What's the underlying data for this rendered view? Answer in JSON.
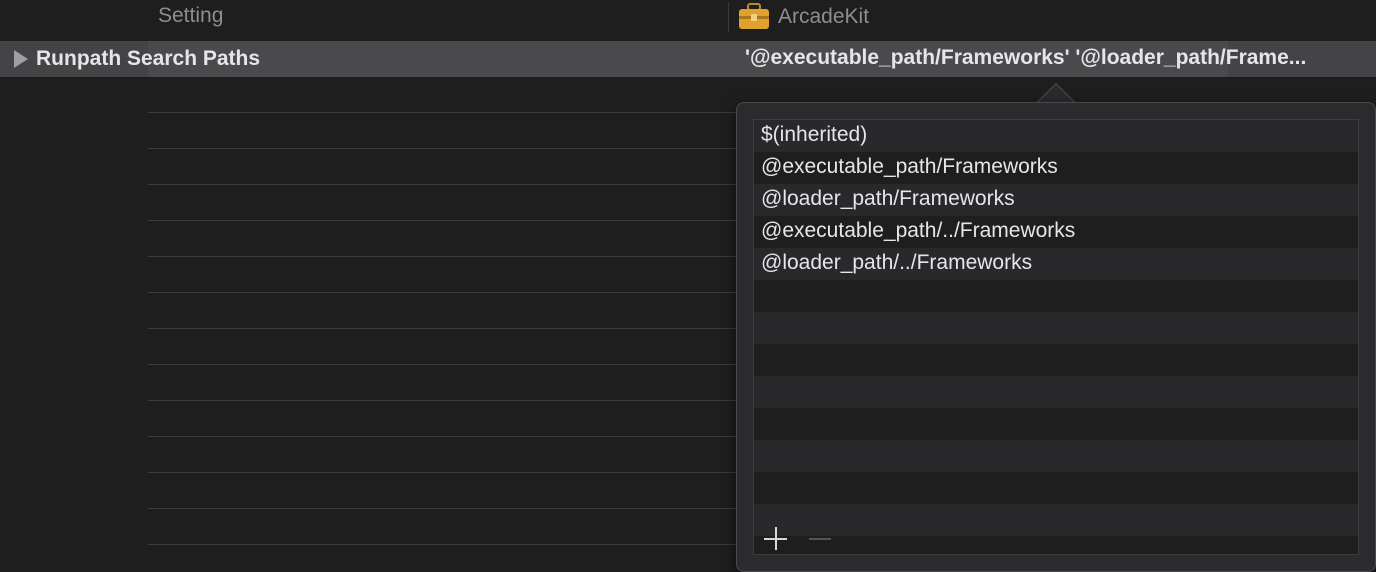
{
  "header": {
    "setting_column": "Setting",
    "target_column": "ArcadeKit",
    "target_icon": "toolbox-icon"
  },
  "setting_row": {
    "name": "Runpath Search Paths",
    "value": "'@executable_path/Frameworks' '@loader_path/Frame...",
    "disclosure_icon": "disclosure-triangle-right-icon"
  },
  "popover": {
    "items": [
      "$(inherited)",
      "@executable_path/Frameworks",
      "@loader_path/Frameworks",
      "@executable_path/../Frameworks",
      "@loader_path/../Frameworks"
    ],
    "add_icon": "plus-icon",
    "remove_icon": "minus-icon"
  },
  "colors": {
    "background": "#1e1e1f",
    "selected_row": "#4a4a4c",
    "text": "#e6e6e8",
    "dim_text": "#8d8d92"
  }
}
